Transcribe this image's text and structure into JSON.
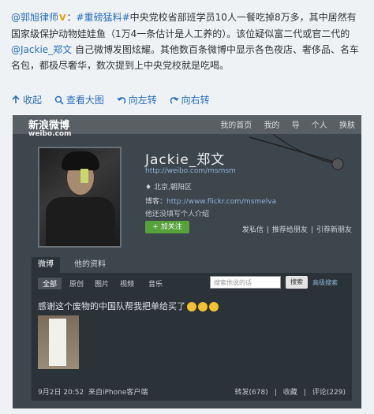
{
  "post": {
    "author": "@郭旭律师",
    "vip": "V",
    "colon": "：",
    "hashtag": "#重磅猛料#",
    "text1": "中央党校省部班学员10人一餐吃掉8万多，其中居然有国家级保护动物娃娃鱼（1万4一条估计是人工养的）。该位疑似富二代或官二代的",
    "mention": "@Jackie_郑文",
    "text2": " 自己微博发图炫耀。其他数百条微博中显示各色夜店、奢侈品、名车名包，都极尽奢华，数次提到上中央党校就是吃喝。"
  },
  "actions": {
    "collapse": "收起",
    "view_large": "查看大图",
    "rotate_left": "向左转",
    "rotate_right": "向右转"
  },
  "screenshot": {
    "logo": "新浪微博",
    "logo_sub": "weibo.com",
    "nav": [
      "我的首页",
      "我的",
      "导",
      "个人",
      "换肤"
    ],
    "profile": {
      "name": "Jackie_郑文",
      "url": "http://weibo.com/msmsm",
      "location": "北京,朝阳区",
      "blog_label": "博客：",
      "blog_url": "http://www.flickr.com/msmelva",
      "desc": "他还没填写个人介绍",
      "follow": "+ 加关注",
      "links": [
        "发私信",
        "|",
        "推荐给朋友",
        "|",
        "引荐新朋友"
      ]
    },
    "tabs": [
      "微博",
      "他的资料"
    ],
    "filters": [
      "全部",
      "原创",
      "图片",
      "视频",
      "音乐"
    ],
    "search_placeholder": "搜索他说的话",
    "search_btn": "搜索",
    "advanced": "高级搜索",
    "weibo": {
      "text": "感谢这个废物的中国队帮我把单给买了",
      "date": "9月2日 20:52",
      "source": "来自iPhone客户端",
      "repost": "转发(678)",
      "sep": "|",
      "fav": "收藏",
      "comment": "评论(229)"
    }
  }
}
